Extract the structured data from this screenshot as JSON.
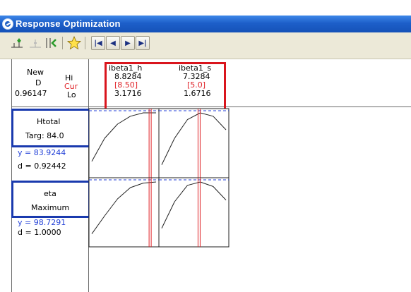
{
  "window": {
    "title": "Response Optimization"
  },
  "toolbar": {
    "buttons": [
      {
        "name": "add-point-icon"
      },
      {
        "name": "remove-point-icon"
      },
      {
        "name": "restore-settings-icon"
      },
      {
        "name": "star-icon"
      },
      {
        "name": "first-icon",
        "glyph": "|◀"
      },
      {
        "name": "prev-icon",
        "glyph": "◀"
      },
      {
        "name": "next-icon",
        "glyph": "▶"
      },
      {
        "name": "last-icon",
        "glyph": "▶|"
      }
    ]
  },
  "optimal": {
    "label_new": "New",
    "label_d": "D",
    "d_value": "0.96147",
    "hi": "Hi",
    "cur": "Cur",
    "lo": "Lo"
  },
  "factors": [
    {
      "name": "ibeta1_h",
      "hi": "8.8284",
      "cur": "[8.50]",
      "lo": "3.1716",
      "cur_frac": 0.89
    },
    {
      "name": "ibeta1_s",
      "hi": "7.3284",
      "cur": "[5.0]",
      "lo": "1.6716",
      "cur_frac": 0.59
    }
  ],
  "responses": [
    {
      "name": "Htotal",
      "goal": "Targ: 84.0",
      "y": "y = 83.9244",
      "d": "d = 0.92442"
    },
    {
      "name": "eta",
      "goal": "Maximum",
      "y": "y = 98.7291",
      "d": "d = 1.0000"
    }
  ],
  "colors": {
    "title_bar": "#1d5fc9",
    "highlight_red": "#d9151d",
    "highlight_blue": "#1a3aae",
    "cur_line": "#e0242a",
    "target_line": "#2442d8"
  }
}
